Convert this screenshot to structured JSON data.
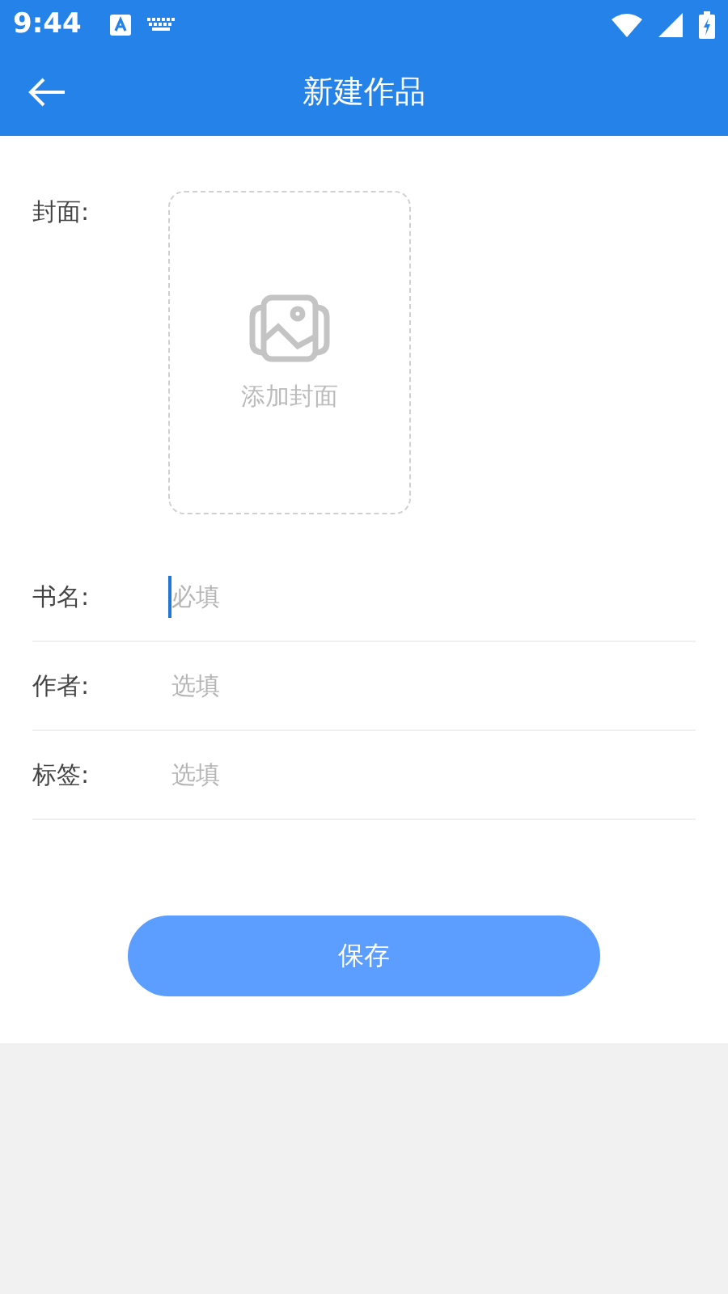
{
  "status_bar": {
    "time": "9:44"
  },
  "app_bar": {
    "title": "新建作品"
  },
  "cover": {
    "label": "封面:",
    "hint": "添加封面"
  },
  "fields": [
    {
      "label": "书名:",
      "placeholder": "必填",
      "focused": true
    },
    {
      "label": "作者:",
      "placeholder": "选填",
      "focused": false
    },
    {
      "label": "标签:",
      "placeholder": "选填",
      "focused": false
    }
  ],
  "save_button": "保存"
}
